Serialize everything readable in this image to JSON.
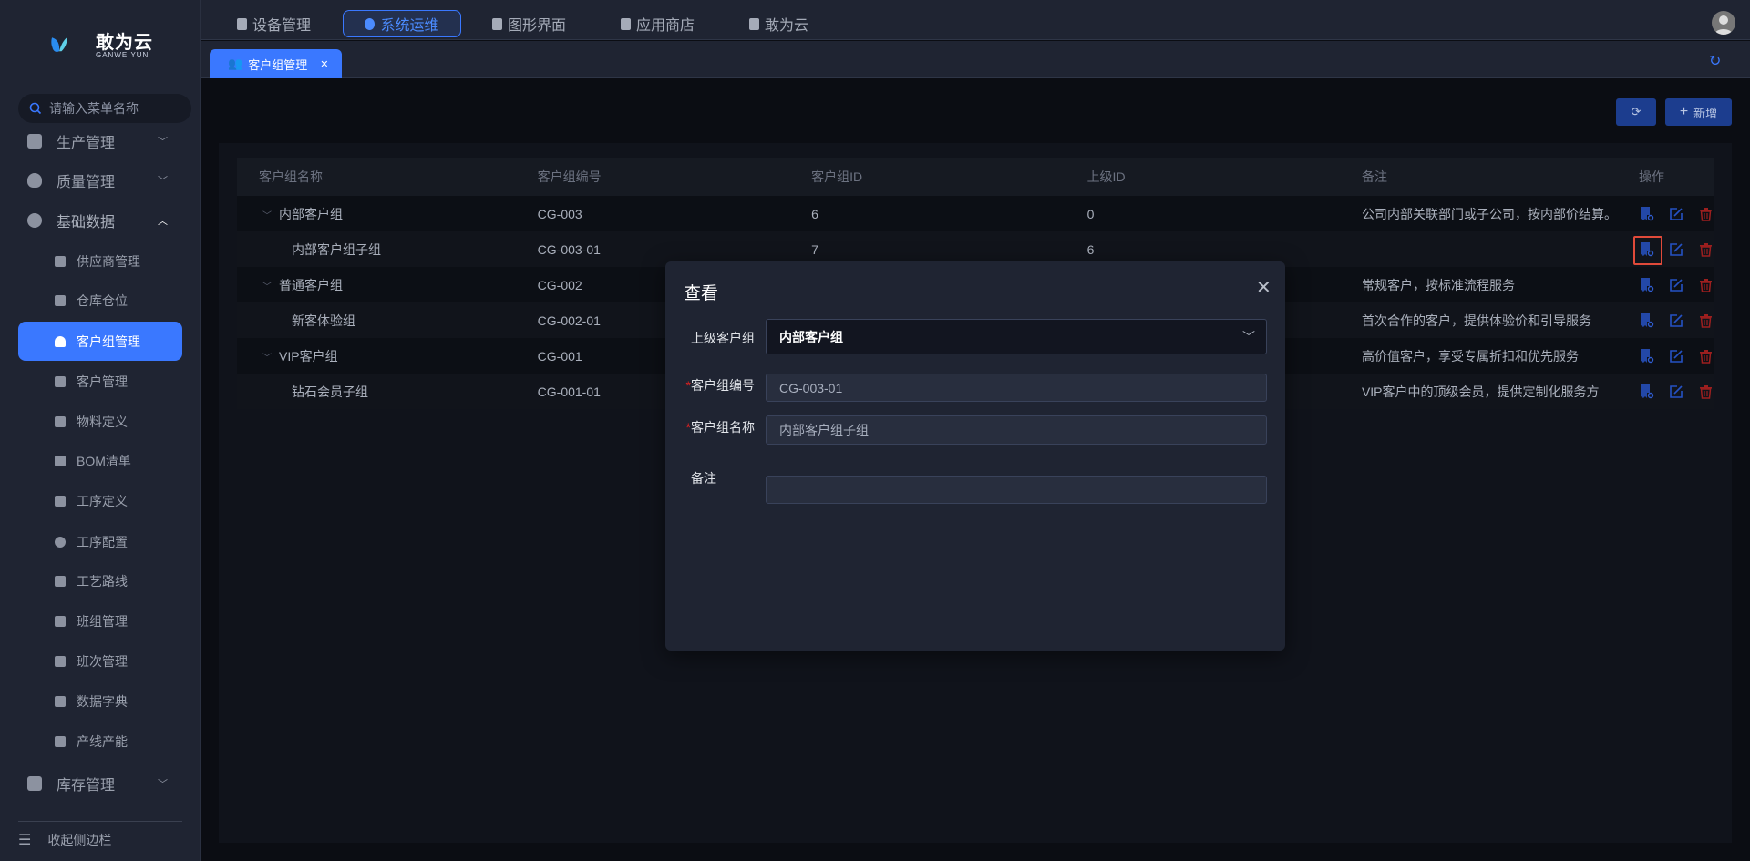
{
  "brand": {
    "name": "敢为云",
    "sub": "GANWEIYUN"
  },
  "sidebar": {
    "search_placeholder": "请输入菜单名称",
    "groups": [
      {
        "label": "生产管理"
      },
      {
        "label": "质量管理"
      },
      {
        "label": "基础数据"
      }
    ],
    "children": [
      {
        "label": "供应商管理"
      },
      {
        "label": "仓库仓位"
      },
      {
        "label": "客户组管理"
      },
      {
        "label": "客户管理"
      },
      {
        "label": "物料定义"
      },
      {
        "label": "BOM清单"
      },
      {
        "label": "工序定义"
      },
      {
        "label": "工序配置"
      },
      {
        "label": "工艺路线"
      },
      {
        "label": "班组管理"
      },
      {
        "label": "班次管理"
      },
      {
        "label": "数据字典"
      },
      {
        "label": "产线产能"
      }
    ],
    "inventory": "库存管理",
    "collapse": "收起侧边栏"
  },
  "topnav": [
    {
      "label": "设备管理"
    },
    {
      "label": "系统运维"
    },
    {
      "label": "图形界面"
    },
    {
      "label": "应用商店"
    },
    {
      "label": "敢为云"
    }
  ],
  "page_tab": {
    "label": "客户组管理",
    "close": "✕"
  },
  "toolbar": {
    "add": "新增"
  },
  "table": {
    "headers": [
      "客户组名称",
      "客户组编号",
      "客户组ID",
      "上级ID",
      "备注",
      "操作"
    ],
    "rows": [
      {
        "name": "内部客户组",
        "code": "CG-003",
        "id": "6",
        "parent": "0",
        "remark": "公司内部关联部门或子公司，按内部价结算。",
        "level": 0
      },
      {
        "name": "内部客户组子组",
        "code": "CG-003-01",
        "id": "7",
        "parent": "6",
        "remark": "",
        "level": 1
      },
      {
        "name": "普通客户组",
        "code": "CG-002",
        "id": "",
        "parent": "",
        "remark": "常规客户，按标准流程服务",
        "level": 0
      },
      {
        "name": "新客体验组",
        "code": "CG-002-01",
        "id": "",
        "parent": "",
        "remark": "首次合作的客户，提供体验价和引导服务",
        "level": 1
      },
      {
        "name": "VIP客户组",
        "code": "CG-001",
        "id": "",
        "parent": "",
        "remark": "高价值客户，享受专属折扣和优先服务",
        "level": 0
      },
      {
        "name": "钻石会员子组",
        "code": "CG-001-01",
        "id": "",
        "parent": "",
        "remark": "VIP客户中的顶级会员，提供定制化服务方",
        "level": 1
      }
    ]
  },
  "modal": {
    "title": "查看",
    "close": "✕",
    "fields": {
      "parent_label": "上级客户组",
      "parent_value": "内部客户组",
      "code_label": "客户组编号",
      "code_value": "CG-003-01",
      "name_label": "客户组名称",
      "name_value": "内部客户组子组",
      "remark_label": "备注",
      "remark_value": "",
      "required_mark": "*"
    }
  },
  "colors": {
    "accent": "#3a78ff",
    "danger": "#c42b2b",
    "highlight": "#e04a3a"
  }
}
